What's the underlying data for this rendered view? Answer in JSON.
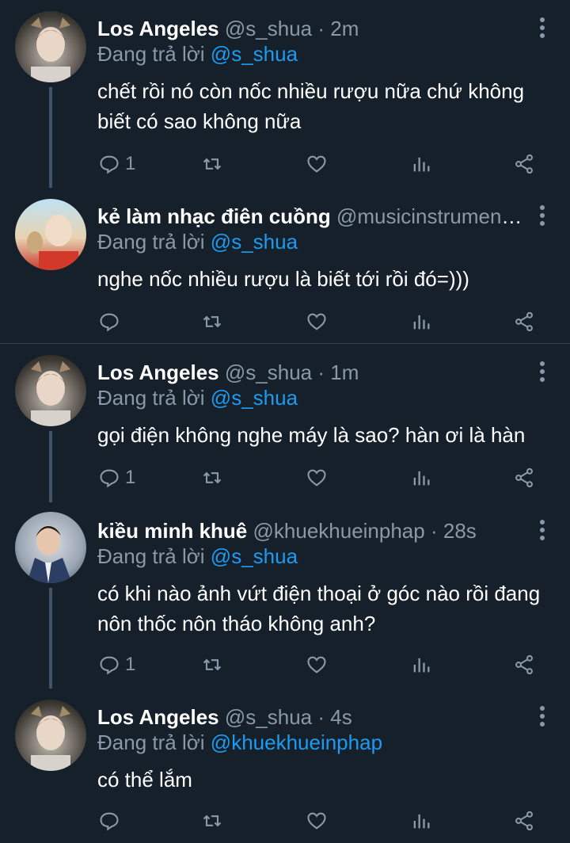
{
  "colors": {
    "background": "#15202b",
    "text": "#ffffff",
    "muted": "#8b98a5",
    "mention": "#1d9bf0",
    "divider": "#38444d"
  },
  "tweets": [
    {
      "name": "Los Angeles",
      "handle": "@s_shua",
      "sep": "·",
      "time": "2m",
      "replying_label": "Đang trả lời",
      "replying_to": "@s_shua",
      "text": "chết rồi nó còn nốc nhiều rượu nữa chứ không biết có sao không nữa",
      "reply_count": "1"
    },
    {
      "name": "kẻ làm nhạc điên cuồng",
      "handle": "@musicinstrument ...",
      "sep": "",
      "time": "",
      "replying_label": "Đang trả lời",
      "replying_to": "@s_shua",
      "text": "nghe nốc nhiều rượu là biết tới rồi đó=)))",
      "reply_count": ""
    },
    {
      "name": "Los Angeles",
      "handle": "@s_shua",
      "sep": "·",
      "time": "1m",
      "replying_label": "Đang trả lời",
      "replying_to": "@s_shua",
      "text": "gọi điện không nghe máy là sao? hàn ơi là hàn",
      "reply_count": "1"
    },
    {
      "name": "kiều minh khuê",
      "handle": "@khuekhueinphap",
      "sep": "·",
      "time": "28s",
      "replying_label": "Đang trả lời",
      "replying_to": "@s_shua",
      "text": "có khi nào ảnh vứt điện thoại ở góc nào rồi đang nôn thốc nôn tháo không anh?",
      "reply_count": "1"
    },
    {
      "name": "Los Angeles",
      "handle": "@s_shua",
      "sep": "·",
      "time": "4s",
      "replying_label": "Đang trả lời",
      "replying_to": "@khuekhueinphap",
      "text": "có thể lắm",
      "reply_count": ""
    }
  ]
}
